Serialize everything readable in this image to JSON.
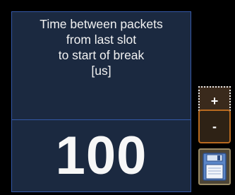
{
  "screen": {
    "description_lines": [
      "Time between packets",
      "from last slot",
      "to start of break",
      "[us]"
    ],
    "value": "100"
  },
  "buttons": {
    "increment_label": "+",
    "decrement_label": "-",
    "save_icon": "floppy-disk-icon"
  },
  "colors": {
    "panel_border": "#3458a8",
    "panel_background": "#1b2940",
    "button_accent": "#b86a20",
    "text": "#f2f2f2"
  }
}
